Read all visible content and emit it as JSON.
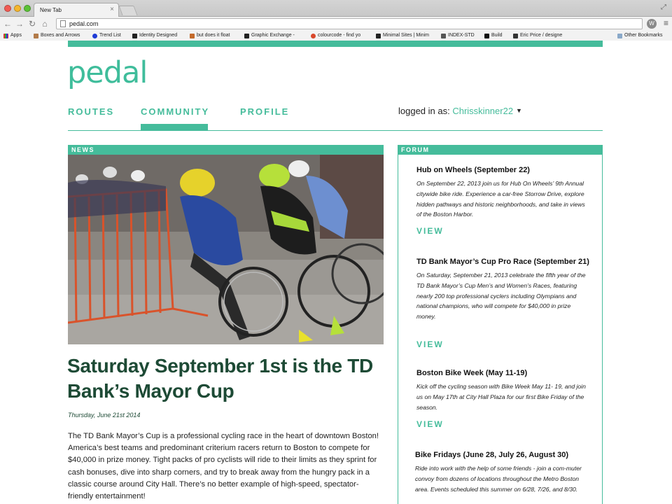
{
  "browser": {
    "tab_title": "New Tab",
    "url": "pedal.com",
    "apps_label": "Apps",
    "bookmarks": [
      {
        "label": "Boxes and Arrows",
        "color": "#b37b4a"
      },
      {
        "label": "Trend List",
        "color": "#1f3bd6"
      },
      {
        "label": "Identity Designed",
        "color": "#222222"
      },
      {
        "label": "but does it float",
        "color": "#c46a2b"
      },
      {
        "label": "Graphic Exchange -",
        "color": "#222222"
      },
      {
        "label": "colourcode - find yo",
        "color": "#d9472b"
      },
      {
        "label": "Minimal Sites | Minim",
        "color": "#222222"
      },
      {
        "label": "INDEX-STD",
        "color": "#555555"
      },
      {
        "label": "Build",
        "color": "#111111"
      },
      {
        "label": "Eric Price / designe",
        "color": "#333333"
      }
    ],
    "other_bookmarks": "Other Bookmarks"
  },
  "site": {
    "logo": "pedal",
    "nav": [
      {
        "label": "ROUTES"
      },
      {
        "label": "COMMUNITY"
      },
      {
        "label": "PROFILE"
      }
    ],
    "active_nav": "COMMUNITY",
    "logged_in_prefix": "logged in as: ",
    "username": "Chrisskinner22",
    "accent_color": "#45bc9b",
    "headline_color": "#1d4a35"
  },
  "news": {
    "section_label": "NEWS",
    "headline": "Saturday September 1st is the TD Bank’s Mayor Cup",
    "date": "Thursday, June 21st 2014",
    "body": "The TD Bank Mayor’s Cup is a professional cycling race in the heart of downtown Boston! America’s best teams and predominant criterium racers return to Boston to compete for $40,000 in prize money. Tight packs of pro cyclists will ride to their limits as they sprint for cash bonuses, dive into sharp corners, and try to break away from the hungry pack in a classic course around City Hall. There’s no better example of high-speed, spectator-friendly entertainment!"
  },
  "forum": {
    "section_label": "FORUM",
    "view_label": "VIEW",
    "posts": [
      {
        "title": "Hub on Wheels (September 22)",
        "text": "On September 22, 2013 join us for Hub On Wheels’ 9th Annual citywide bike ride. Experience a car-free Storrow Drive, explore hidden pathways and historic neighborhoods, and take in views of the Boston Harbor."
      },
      {
        "title": "TD Bank Mayor’s Cup Pro Race (September 21)",
        "text": "On Saturday, September 21, 2013 celebrate the fifth year of the TD Bank Mayor’s Cup Men’s and Women’s Races, featuring nearly 200 top professional cyclers including Olympians and national champions, who will compete for $40,000 in prize money."
      },
      {
        "title": "Boston Bike Week (May 11-19)",
        "text": "Kick off the cycling season with Bike Week May 11- 19, and join us on May 17th at City Hall Plaza for our first Bike Friday of the season."
      },
      {
        "title": "Bike Fridays (June 28, July 26, August 30)",
        "text": "Ride into work with the help of some friends - join a com-muter convoy from dozens of locations throughout the Metro Boston area. Events scheduled this summer on 6/28, 7/26, and 8/30."
      }
    ]
  }
}
